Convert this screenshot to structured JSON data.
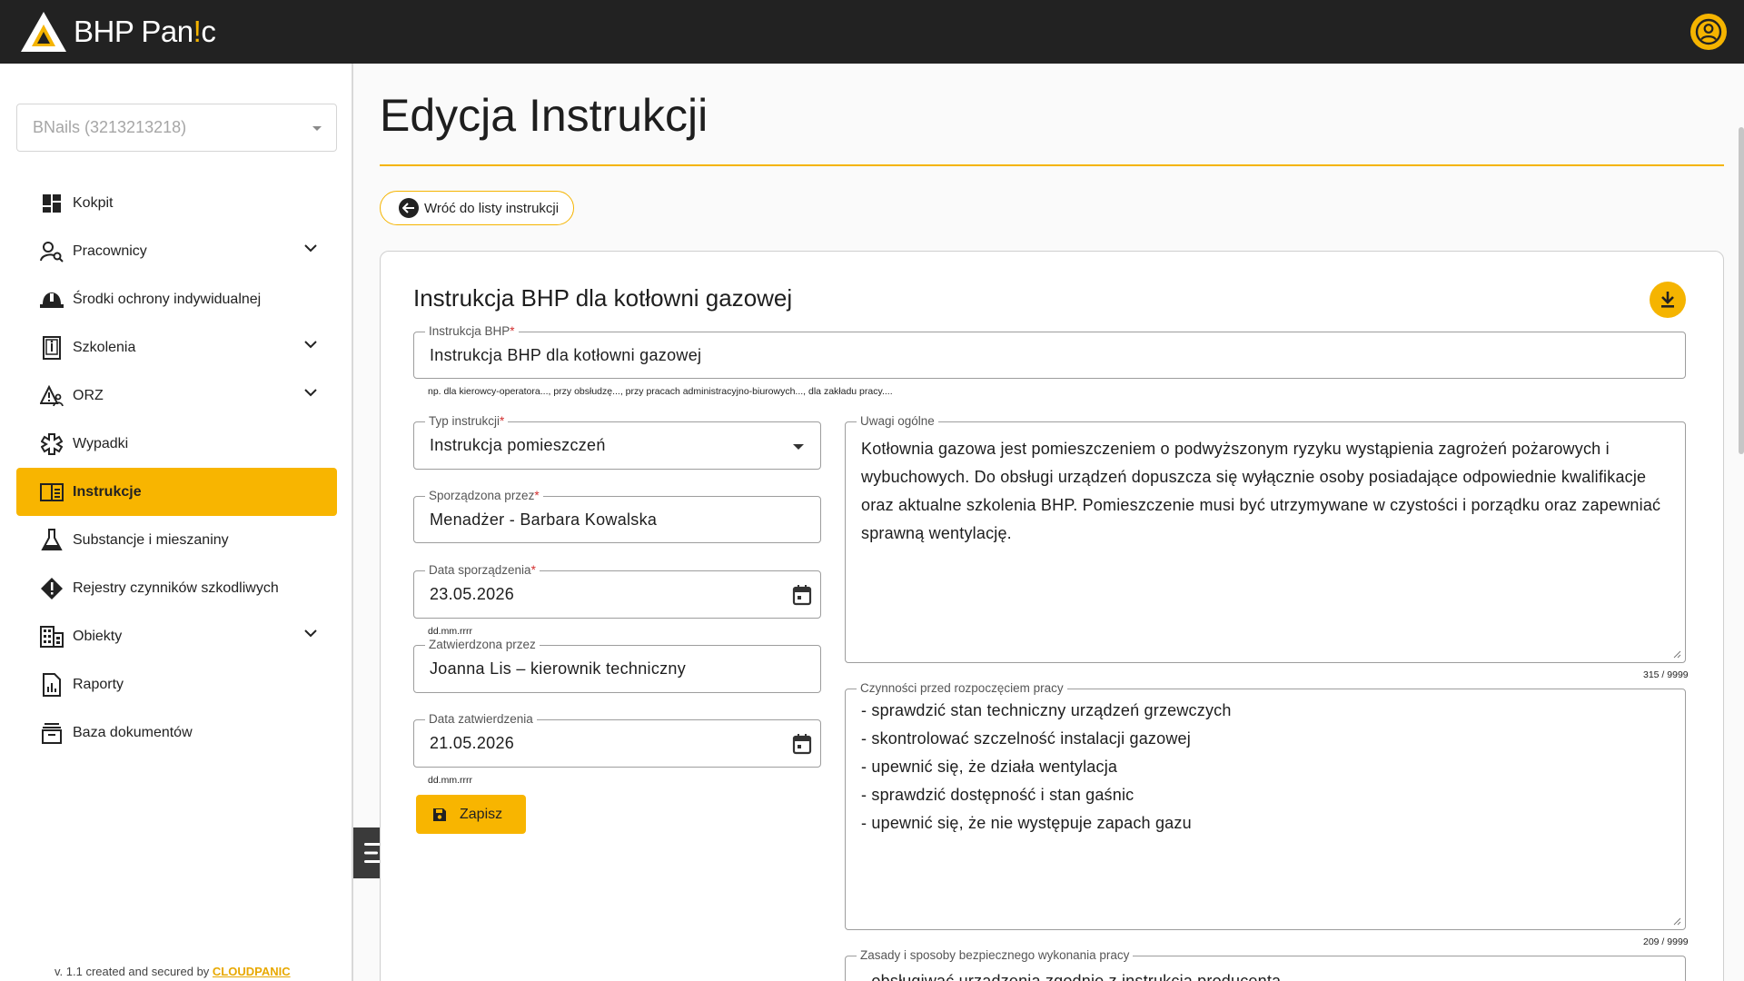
{
  "app": {
    "brand": "BHP Panic",
    "brand_parts": [
      "BHP Pan",
      "!",
      "c"
    ],
    "accent_color": "#f5b400",
    "topbar_color": "#222222"
  },
  "sidebar": {
    "company_select": {
      "value": "BNails (3213213218)"
    },
    "items": [
      {
        "label": "Kokpit",
        "icon": "dashboard-icon",
        "expandable": false,
        "active": false
      },
      {
        "label": "Pracownicy",
        "icon": "person-search-icon",
        "expandable": true,
        "active": false
      },
      {
        "label": "Środki ochrony indywidualnej",
        "icon": "helmet-icon",
        "expandable": false,
        "active": false
      },
      {
        "label": "Szkolenia",
        "icon": "training-book-icon",
        "expandable": true,
        "active": false
      },
      {
        "label": "ORZ",
        "icon": "warning-person-icon",
        "expandable": true,
        "active": false
      },
      {
        "label": "Wypadki",
        "icon": "medical-cross-icon",
        "expandable": false,
        "active": false
      },
      {
        "label": "Instrukcje",
        "icon": "instructions-book-icon",
        "expandable": false,
        "active": true
      },
      {
        "label": "Substancje i mieszaniny",
        "icon": "flask-icon",
        "expandable": false,
        "active": false
      },
      {
        "label": "Rejestry czynników szkodliwych",
        "icon": "hazard-diamond-icon",
        "expandable": false,
        "active": false
      },
      {
        "label": "Obiekty",
        "icon": "building-icon",
        "expandable": true,
        "active": false
      },
      {
        "label": "Raporty",
        "icon": "report-icon",
        "expandable": false,
        "active": false
      },
      {
        "label": "Baza dokumentów",
        "icon": "archive-icon",
        "expandable": false,
        "active": false
      }
    ],
    "footer": {
      "prefix": "v. 1.1 created and secured by ",
      "link": "CLOUDPANIC"
    }
  },
  "main": {
    "page_title": "Edycja Instrukcji",
    "back_button": "Wróć do listy instrukcji",
    "card": {
      "title": "Instrukcja BHP dla kotłowni gazowej",
      "name_field": {
        "label": "Instrukcja BHP",
        "required": "*",
        "value": "Instrukcja BHP dla kotłowni gazowej",
        "hint": "np. dla kierowcy-operatora..., przy obsłudzę..., przy pracach administracyjno-biurowych..., dla zakładu pracy...."
      },
      "type_field": {
        "label": "Typ instrukcji",
        "required": "*",
        "value": "Instrukcja pomieszczeń"
      },
      "author_field": {
        "label": "Sporządzona przez",
        "required": "*",
        "value": "Menadżer - Barbara Kowalska"
      },
      "created_date_field": {
        "label": "Data sporządzenia",
        "required": "*",
        "value": "23.05.2026",
        "hint": "dd.mm.rrrr"
      },
      "approved_by_field": {
        "label": "Zatwierdzona przez",
        "value": "Joanna Lis – kierownik techniczny"
      },
      "approved_date_field": {
        "label": "Data zatwierdzenia",
        "value": "21.05.2026",
        "hint": "dd.mm.rrrr"
      },
      "save_button": "Zapisz",
      "general_notes": {
        "label": "Uwagi ogólne",
        "value": "Kotłownia gazowa jest pomieszczeniem o podwyższonym ryzyku wystąpienia zagrożeń pożarowych i wybuchowych. Do obsługi urządzeń dopuszcza się wyłącznie osoby posiadające odpowiednie kwalifikacje oraz aktualne szkolenia BHP. Pomieszczenie musi być utrzymywane w czystości i porządku oraz zapewniać sprawną wentylację.",
        "counter": "315 / 9999"
      },
      "before_work": {
        "label": "Czynności przed rozpoczęciem pracy",
        "value": "- sprawdzić stan techniczny urządzeń grzewczych\n- skontrolować szczelność instalacji gazowej\n- upewnić się, że działa wentylacja\n- sprawdzić dostępność i stan gaśnic\n- upewnić się, że nie występuje zapach gazu",
        "counter": "209 / 9999"
      },
      "safe_work": {
        "label": "Zasady i sposoby bezpiecznego wykonania pracy",
        "value": "- obsługiwać urządzenia zgodnie z instrukcją producenta"
      }
    }
  }
}
